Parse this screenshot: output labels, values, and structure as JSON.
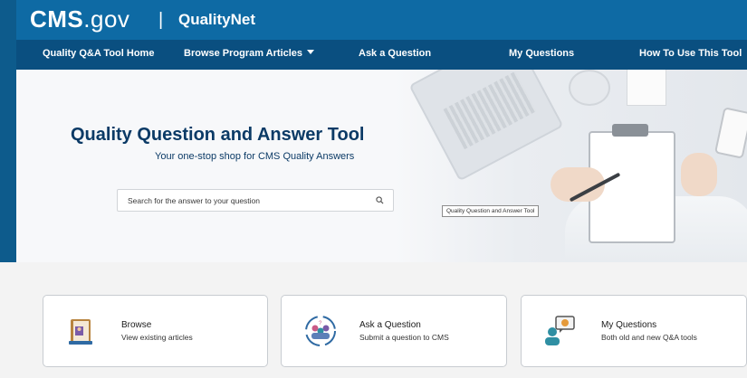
{
  "header": {
    "brand_main": "CMS",
    "brand_suffix": ".gov",
    "divider": "|",
    "product": "QualityNet"
  },
  "nav": {
    "items": [
      {
        "label": "Quality Q&A Tool Home"
      },
      {
        "label": "Browse Program Articles"
      },
      {
        "label": "Ask a Question"
      },
      {
        "label": "My Questions"
      },
      {
        "label": "How To Use This Tool"
      }
    ]
  },
  "hero": {
    "title": "Quality Question and Answer Tool",
    "subtitle": "Your one-stop shop for CMS Quality Answers",
    "search_placeholder": "Search for the answer to your question",
    "tooltip": "Quality Question and Answer Tool"
  },
  "cards": [
    {
      "title": "Browse",
      "description": "View existing articles",
      "icon": "book-icon"
    },
    {
      "title": "Ask a Question",
      "description": "Submit a question to CMS",
      "icon": "people-question-icon"
    },
    {
      "title": "My Questions",
      "description": "Both old and new Q&A tools",
      "icon": "user-chat-icon"
    }
  ],
  "colors": {
    "header_blue": "#0e6aa4",
    "nav_blue": "#0a4f80",
    "title_navy": "#0b3a66"
  }
}
